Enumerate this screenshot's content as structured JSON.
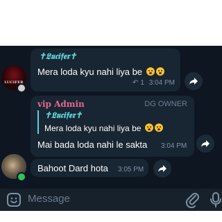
{
  "messages": [
    {
      "sender_display": "✝𝕷𝖚𝖈𝖎𝖋𝖊𝖗✝",
      "text": "Mera loda kyu nahi liya be",
      "replies_count": "1",
      "time": "3:04 PM",
      "avatar_label": "LUCIFER"
    },
    {
      "sender_name": "vip Admin",
      "role": "DG OWNER",
      "quote_sender": "✝𝕷𝖚𝖈𝖎𝖋𝖊𝖗✝",
      "quote_text": "Mera loda kyu nahi liya be",
      "text": "Mai bada loda nahi le sakta",
      "time": "3:04 PM"
    },
    {
      "text": "Bahoot Dard hota",
      "time": "3:05 PM"
    }
  ],
  "composer": {
    "placeholder": "Message"
  },
  "icons": {
    "emoji": "emoji-sticker-icon",
    "attach": "paperclip-icon",
    "mic": "microphone-icon",
    "share": "share-arrow-icon",
    "reply": "reply-arrow-icon"
  },
  "colors": {
    "chat_bg": "#0e1621",
    "bubble": "#182533",
    "accent_cyan": "#5fd1d8",
    "admin_pink": "#e66a8a"
  }
}
